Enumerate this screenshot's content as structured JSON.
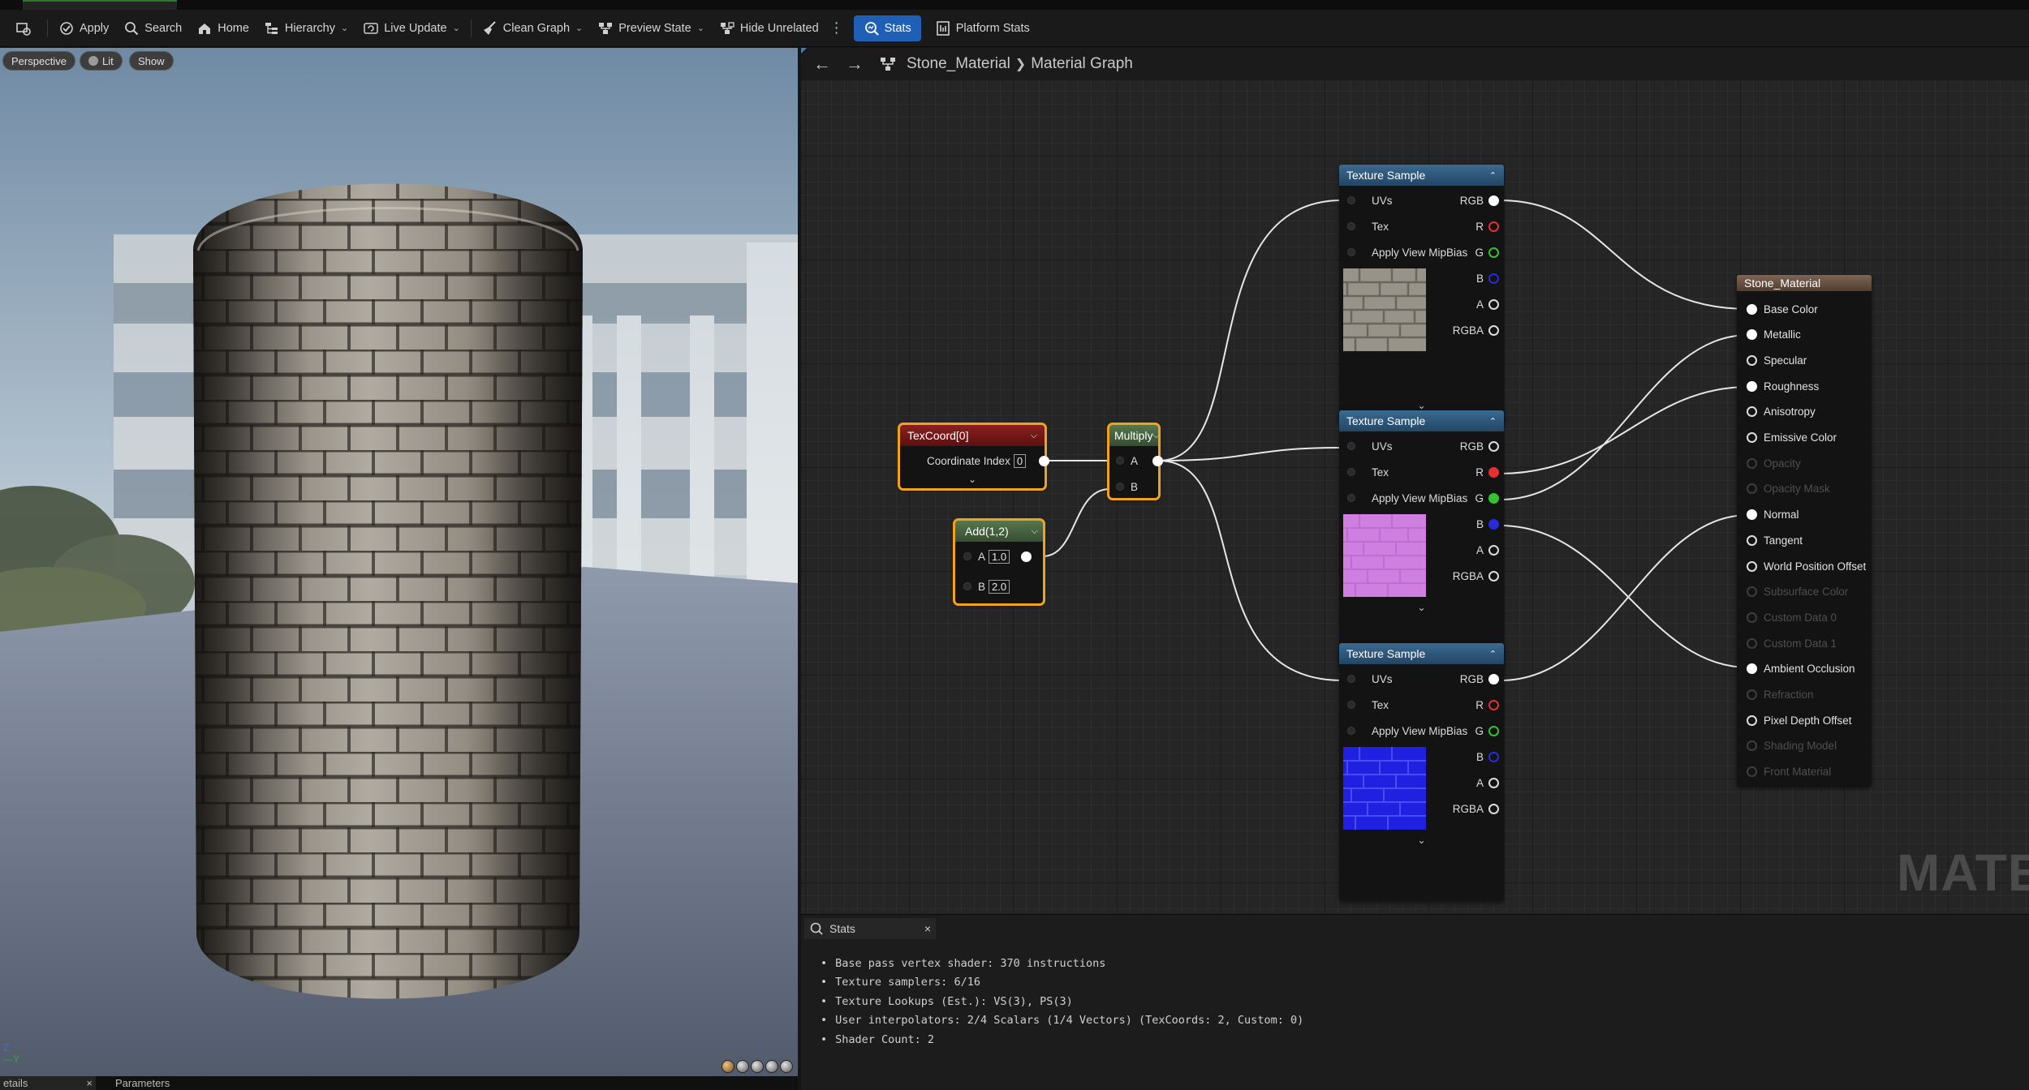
{
  "toolbar": {
    "apply": "Apply",
    "search": "Search",
    "home": "Home",
    "hierarchy": "Hierarchy",
    "live_update": "Live Update",
    "clean_graph": "Clean Graph",
    "preview_state": "Preview State",
    "hide_unrelated": "Hide Unrelated",
    "stats": "Stats",
    "platform_stats": "Platform Stats"
  },
  "viewport": {
    "perspective": "Perspective",
    "lit": "Lit",
    "show": "Show",
    "axis_z": "Z",
    "axis_y": "Y"
  },
  "bottom_tabs": {
    "details": "etails",
    "parameters": "Parameters",
    "close": "×"
  },
  "graph": {
    "breadcrumb_asset": "Stone_Material",
    "breadcrumb_graph": "Material Graph",
    "watermark": "MATERIAL",
    "nodes": {
      "texcoord": {
        "title": "TexCoord[0]",
        "param_label": "Coordinate Index",
        "param_value": "0"
      },
      "multiply": {
        "title": "Multiply",
        "a": "A",
        "b": "B"
      },
      "add": {
        "title": "Add(1,2)",
        "a": "A",
        "a_value": "1.0",
        "b": "B",
        "b_value": "2.0"
      },
      "texture_samples": [
        {
          "title": "Texture Sample",
          "inputs": [
            "UVs",
            "Tex",
            "Apply View MipBias"
          ],
          "outputs": [
            "RGB",
            "R",
            "G",
            "B",
            "A",
            "RGBA"
          ],
          "preview_color": "#8a8479"
        },
        {
          "title": "Texture Sample",
          "inputs": [
            "UVs",
            "Tex",
            "Apply View MipBias"
          ],
          "outputs": [
            "RGB",
            "R",
            "G",
            "B",
            "A",
            "RGBA"
          ],
          "preview_color": "#d080e0"
        },
        {
          "title": "Texture Sample",
          "inputs": [
            "UVs",
            "Tex",
            "Apply View MipBias"
          ],
          "outputs": [
            "RGB",
            "R",
            "G",
            "B",
            "A",
            "RGBA"
          ],
          "preview_color": "#2020e0"
        }
      ],
      "result": {
        "title": "Stone_Material",
        "pins": [
          {
            "label": "Base Color",
            "state": "connected"
          },
          {
            "label": "Metallic",
            "state": "connected"
          },
          {
            "label": "Specular",
            "state": "active"
          },
          {
            "label": "Roughness",
            "state": "connected"
          },
          {
            "label": "Anisotropy",
            "state": "active"
          },
          {
            "label": "Emissive Color",
            "state": "active"
          },
          {
            "label": "Opacity",
            "state": "disabled"
          },
          {
            "label": "Opacity Mask",
            "state": "disabled"
          },
          {
            "label": "Normal",
            "state": "connected"
          },
          {
            "label": "Tangent",
            "state": "active"
          },
          {
            "label": "World Position Offset",
            "state": "active"
          },
          {
            "label": "Subsurface Color",
            "state": "disabled"
          },
          {
            "label": "Custom Data 0",
            "state": "disabled"
          },
          {
            "label": "Custom Data 1",
            "state": "disabled"
          },
          {
            "label": "Ambient Occlusion",
            "state": "connected"
          },
          {
            "label": "Refraction",
            "state": "disabled"
          },
          {
            "label": "Pixel Depth Offset",
            "state": "active"
          },
          {
            "label": "Shading Model",
            "state": "disabled"
          },
          {
            "label": "Front Material",
            "state": "disabled"
          }
        ]
      }
    }
  },
  "stats_panel": {
    "tab_label": "Stats",
    "close": "×",
    "lines": [
      "Base pass vertex shader: 370 instructions",
      "Texture samplers: 6/16",
      "Texture Lookups (Est.): VS(3), PS(3)",
      "User interpolators: 2/4 Scalars (1/4 Vectors) (TexCoords: 2, Custom: 0)",
      "Shader Count: 2"
    ]
  },
  "colors": {
    "accent_blue": "#1f5fb5",
    "selection_orange": "#f0a21e",
    "pin_red": "#e43030",
    "pin_green": "#34c234",
    "pin_blue": "#2a2ad8"
  }
}
